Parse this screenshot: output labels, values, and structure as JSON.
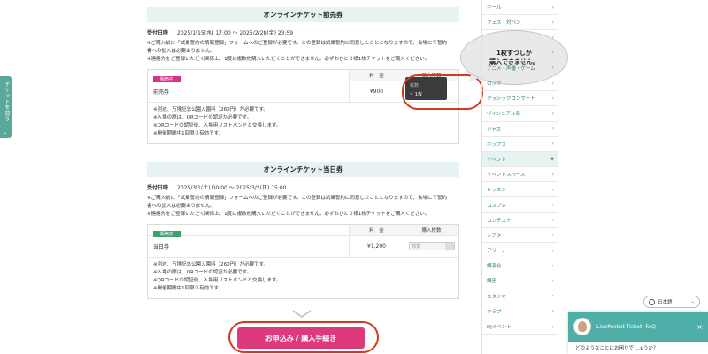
{
  "side_tab": {
    "label": "チケットを買う",
    "chevron": "⌄"
  },
  "presale": {
    "title": "オンラインチケット前売券",
    "period_label": "受付日時",
    "period": "2025/1/15(水) 17:00 〜 2025/2/28(金) 23:59",
    "notes": [
      "※ご購入前に「試乗誓約の情報登録」フォームへのご登録が必要です。この登録は試乗誓約に同意したこととなりますので、会場にて誓約",
      "書への記入は必要ありません。",
      "※連絡先をご登録いただく関係上、1度に複数枚購入いただくことができません。必ずおひとり様1枚チケットをご購入ください。"
    ],
    "col_price": "料　金",
    "col_qty": "購入枚数",
    "badge": "販売中",
    "ticket_name": "前売券",
    "price": "¥900",
    "dropdown_options": [
      "枚数",
      "1枚"
    ],
    "ticket_notes": [
      "※別途、万博記念公園入園料（260円）が必要です。",
      "※入場の際は、QRコードの認証が必要です。",
      "※QRコードの認証後、入場用リストバンドと交換します。",
      "※開催期間中1回限り有効です。"
    ]
  },
  "dayof": {
    "title": "オンラインチケット当日券",
    "period_label": "受付日時",
    "period": "2025/3/1(土) 00:00 〜 2025/3/2(日) 15:00",
    "notes": [
      "※ご購入前に「試乗誓約の情報登録」フォームへのご登録が必要です。この登録は試乗誓約に同意したこととなりますので、会場にて誓約",
      "書への記入は必要ありません。",
      "※連絡先をご登録いただく関係上、1度に複数枚購入いただくことができません。必ずおひとり様1枚チケットをご購入ください。"
    ],
    "col_price": "料　金",
    "col_qty": "購入枚数",
    "badge": "販売前",
    "ticket_name": "当日券",
    "price": "¥1,200",
    "select_placeholder": "枚数",
    "ticket_notes": [
      "※別途、万博記念公園入園料（260円）が必要です。",
      "※入場の際は、QRコードの認証が必要です。",
      "※QRコードの認証後、入場用リストバンドと交換します。",
      "※開催期間中1回限り有効です。"
    ]
  },
  "callout": {
    "line1": "1枚ずつしか",
    "line2": "購入できません。"
  },
  "submit_label": "お申込み / 購入手続き",
  "genres": [
    {
      "label": "ホール",
      "chev": "›"
    },
    {
      "label": "フェス・対バン",
      "chev": "›"
    },
    {
      "label": "",
      "chev": "›"
    },
    {
      "label": "",
      "chev": "›"
    },
    {
      "label": "アニメ・声優・ゲーム",
      "chev": "›"
    },
    {
      "label": "ロック",
      "chev": "›"
    },
    {
      "label": "クラシックコンサート",
      "chev": "›"
    },
    {
      "label": "ヴィジュアル系",
      "chev": "›"
    },
    {
      "label": "ジャズ",
      "chev": "›"
    },
    {
      "label": "ポップス",
      "chev": "›"
    },
    {
      "label": "イベント",
      "chev": "▼",
      "header": true
    },
    {
      "label": "イベントスペース",
      "chev": "›"
    },
    {
      "label": "レッスン",
      "chev": "›"
    },
    {
      "label": "コスプレ",
      "chev": "›"
    },
    {
      "label": "コンテスト",
      "chev": "›"
    },
    {
      "label": "シアター",
      "chev": "›"
    },
    {
      "label": "アリーナ",
      "chev": "›"
    },
    {
      "label": "講演会",
      "chev": "›"
    },
    {
      "label": "講座",
      "chev": "›"
    },
    {
      "label": "スタジオ",
      "chev": "›"
    },
    {
      "label": "クラブ",
      "chev": "›"
    },
    {
      "label": "DJイベント",
      "chev": "›"
    }
  ],
  "language": {
    "label": "日本語",
    "dd": "⌄"
  },
  "faq": {
    "title": "LivePocket-Ticket- FAQ",
    "close": "×",
    "message": "どのようなことにお困りでしょうか？"
  },
  "colors": {
    "accent": "#dd3a7c",
    "teal": "#4dafa7",
    "highlight": "#d33a1c"
  }
}
